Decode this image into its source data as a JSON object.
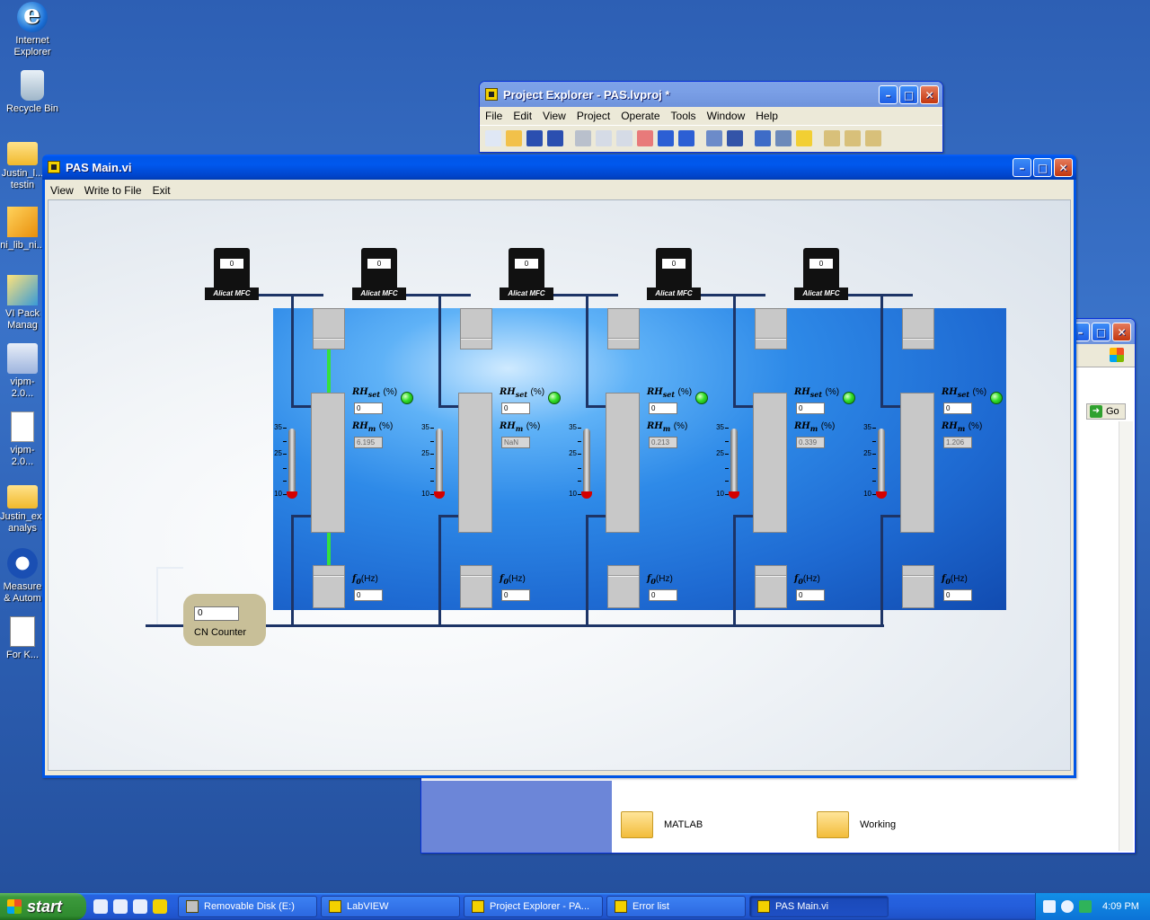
{
  "desktop": {
    "icons": [
      {
        "label": "Internet Explorer"
      },
      {
        "label": "Recycle Bin"
      },
      {
        "label": "Justin_l... testin"
      },
      {
        "label": "ni_lib_ni..."
      },
      {
        "label": "VI Pack Manag"
      },
      {
        "label": "vipm-2.0..."
      },
      {
        "label": "vipm-2.0..."
      },
      {
        "label": "Justin_ex... analys"
      },
      {
        "label": "Measure & Autom"
      },
      {
        "label": "For K..."
      }
    ]
  },
  "project_explorer": {
    "title": "Project Explorer - PAS.lvproj *",
    "menu": [
      "File",
      "Edit",
      "View",
      "Project",
      "Operate",
      "Tools",
      "Window",
      "Help"
    ]
  },
  "explorer": {
    "go_label": "Go",
    "folders": [
      "MATLAB",
      "Working"
    ]
  },
  "pas": {
    "title": "PAS Main.vi",
    "menu": [
      "View",
      "Write to File",
      "Exit"
    ],
    "mfc_label": "Alicat MFC",
    "rh_set_label": "RH",
    "rh_set_sub": "set",
    "rh_m_label": "RH",
    "rh_m_sub": "m",
    "pct": "(%)",
    "f0_label": "f",
    "f0_sub": "0",
    "hz": "(Hz)",
    "thermo_ticks": [
      "35",
      "25",
      "10"
    ],
    "cells": [
      {
        "mfc": "0",
        "rh_set": "0",
        "rh_m": "6.195",
        "f0": "0"
      },
      {
        "mfc": "0",
        "rh_set": "0",
        "rh_m": "NaN",
        "f0": "0"
      },
      {
        "mfc": "0",
        "rh_set": "0",
        "rh_m": "0.213",
        "f0": "0"
      },
      {
        "mfc": "0",
        "rh_set": "0",
        "rh_m": "0.339",
        "f0": "0"
      },
      {
        "mfc": "0",
        "rh_set": "0",
        "rh_m": "1.206",
        "f0": "0"
      }
    ],
    "cn_counter": {
      "value": "0",
      "label": "CN Counter"
    }
  },
  "taskbar": {
    "start": "start",
    "tasks": [
      {
        "label": "Removable Disk (E:)"
      },
      {
        "label": "LabVIEW"
      },
      {
        "label": "Project Explorer - PA..."
      },
      {
        "label": "Error list"
      },
      {
        "label": "PAS Main.vi"
      }
    ],
    "clock": "4:09 PM"
  }
}
